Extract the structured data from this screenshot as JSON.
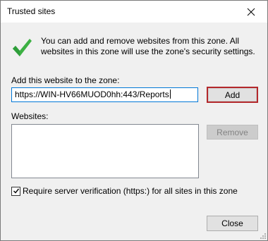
{
  "window": {
    "title": "Trusted sites"
  },
  "info": {
    "message": "You can add and remove websites from this zone. All websites in this zone will use the zone's security settings."
  },
  "add_section": {
    "label": "Add this website to the zone:",
    "input_value": "https://WIN-HV66MUOD0hh:443/Reports",
    "add_button_label": "Add"
  },
  "websites_section": {
    "label": "Websites:",
    "items": [],
    "remove_button_label": "Remove"
  },
  "verification": {
    "checked": true,
    "label": "Require server verification (https:) for all sites in this zone"
  },
  "footer": {
    "close_button_label": "Close"
  },
  "colors": {
    "accent_focus": "#0078d7",
    "default_button_border": "#b3282b",
    "check_icon_green": "#3cb043"
  },
  "icons": {
    "close": "close-icon",
    "check": "checkmark-icon",
    "checkbox_mark": "checkbox-check-icon"
  }
}
